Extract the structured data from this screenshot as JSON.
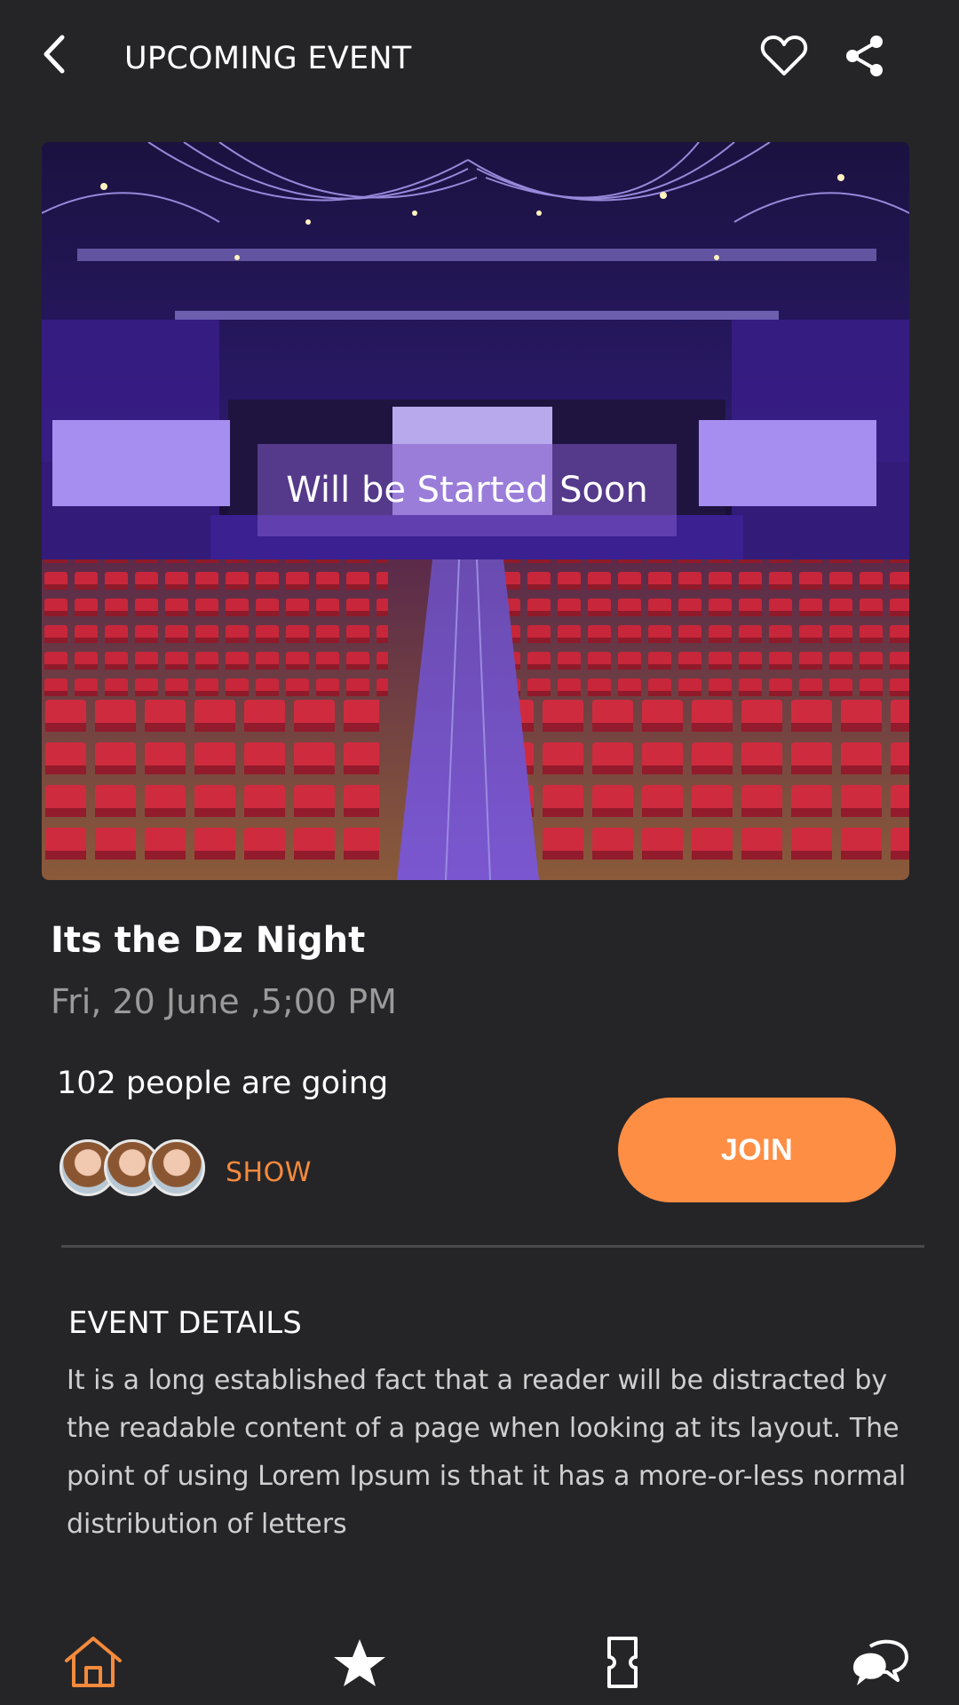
{
  "header": {
    "title": "UPCOMING EVENT",
    "back_icon": "chevron-left-icon",
    "favorite_icon": "heart-icon",
    "share_icon": "share-icon"
  },
  "hero": {
    "banner_text": "Will be Started Soon"
  },
  "event": {
    "title": "Its the Dz Night",
    "date": "Fri, 20 June ,5;00 PM",
    "going_text": "102 people are going",
    "show_label": "SHOW",
    "join_label": "JOIN"
  },
  "details": {
    "title": "EVENT DETAILS",
    "text": "It is a long established fact that a reader will be distracted by the readable content of a page when looking at its layout. The point of using Lorem Ipsum is that it has a more-or-less normal distribution of letters"
  },
  "nav": {
    "items": [
      {
        "icon": "home-icon",
        "active": true
      },
      {
        "icon": "star-icon",
        "active": false
      },
      {
        "icon": "ticket-icon",
        "active": false
      },
      {
        "icon": "chat-icon",
        "active": false
      }
    ]
  },
  "colors": {
    "background": "#252528",
    "accent": "#ff8e45",
    "muted_text": "#9a9a9a"
  }
}
